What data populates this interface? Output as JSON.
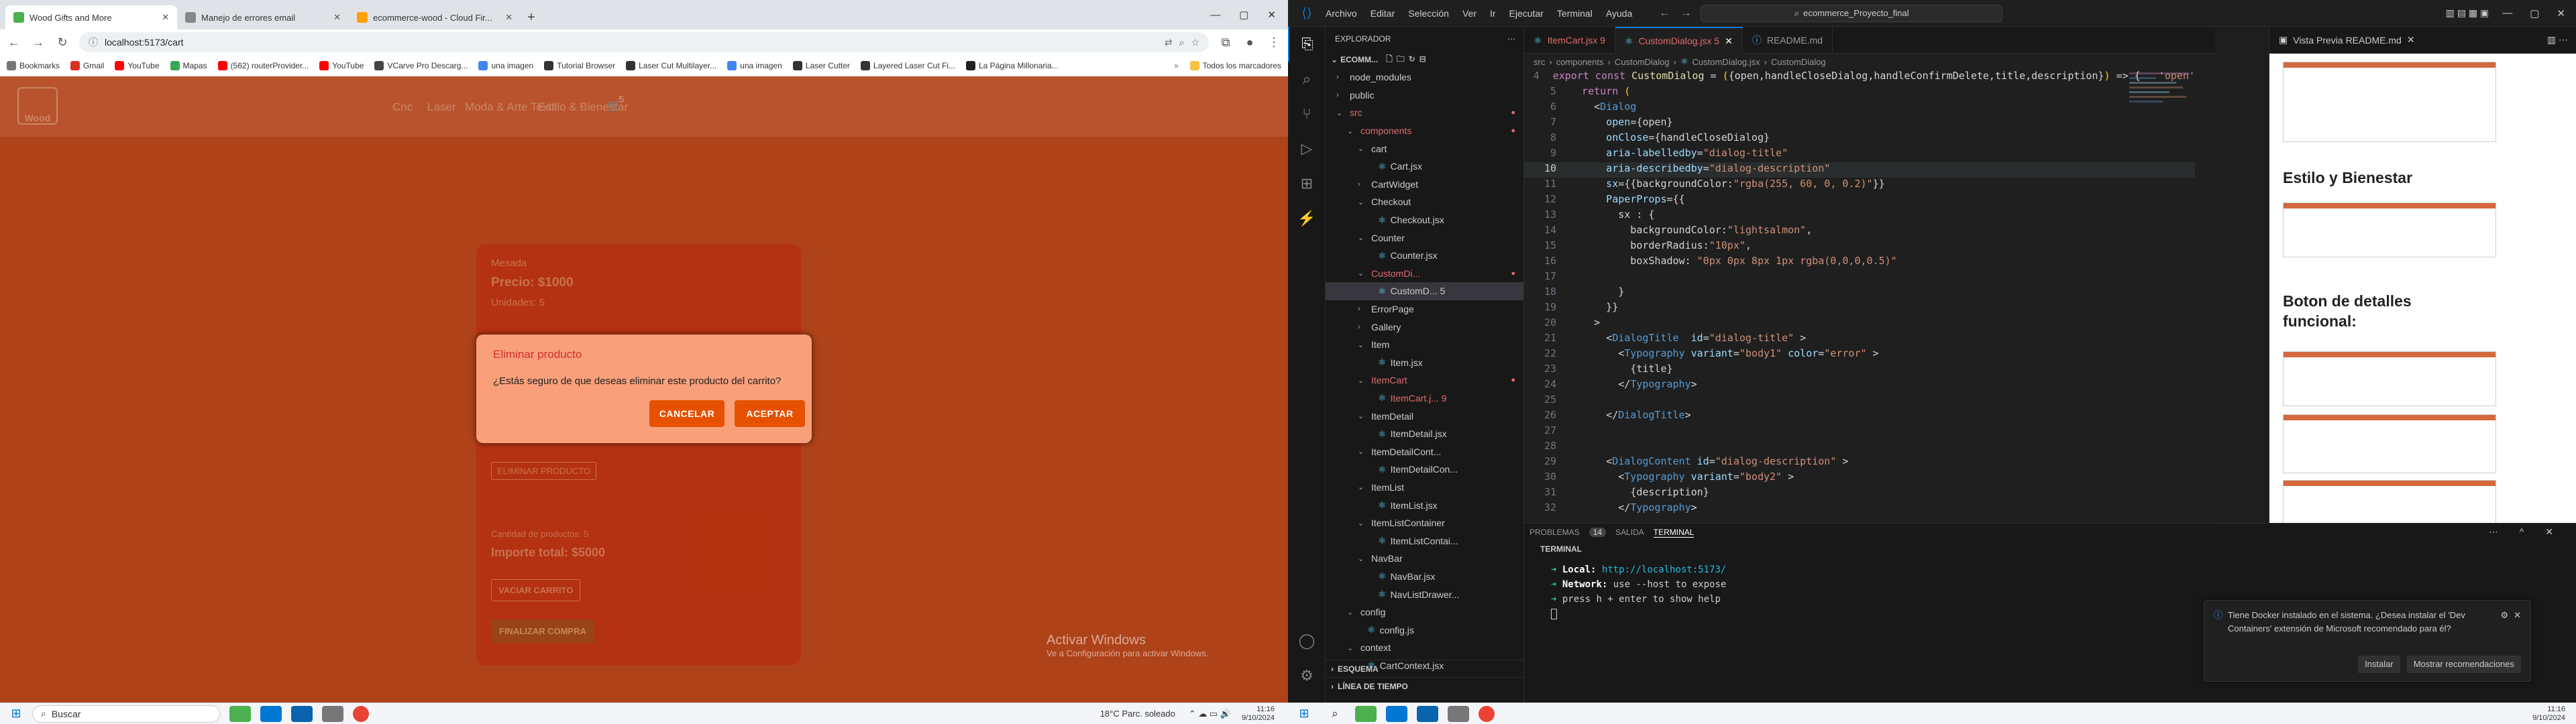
{
  "browser": {
    "tabs": [
      {
        "title": "Wood Gifts and More",
        "active": true,
        "favicon_color": "#4caf50"
      },
      {
        "title": "Manejo de errores email",
        "active": false,
        "favicon_color": "#888"
      },
      {
        "title": "ecommerce-wood - Cloud Fir...",
        "active": false,
        "favicon_color": "#ffa000"
      }
    ],
    "url": "localhost:5173/cart",
    "bookmarks": [
      "Bookmarks",
      "Gmail",
      "YouTube",
      "Mapas",
      "(562) routerProvider...",
      "YouTube",
      "VCarve Pro Descarg...",
      "una imagen",
      "Tutorial Browser",
      "Laser Cut Multilayer...",
      "una imagen",
      "Laser Cutter",
      "Layered Laser Cut Fi...",
      "La Página Millonaria..."
    ],
    "bookmarks_all": "Todos los marcadores"
  },
  "site": {
    "logo": "Wood",
    "nav": [
      "Cnc",
      "Laser",
      "Moda & Arte Textil",
      "Estilo & Bienestar"
    ],
    "cart_count": "5",
    "cart": {
      "item_name": "Mesada",
      "price": "Precio: $1000",
      "units": "Unidades: 5",
      "eliminar": "ELIMINAR PRODUCTO",
      "total_products": "Cantidad de productos: 5",
      "total": "Importe total: $5000",
      "clear": "VACIAR CARRITO",
      "checkout": "FINALIZAR COMPRA"
    },
    "watermark_title": "Activar Windows",
    "watermark_sub": "Ve a Configuración para activar Windows."
  },
  "dialog": {
    "title": "Eliminar producto",
    "description": "¿Estás seguro de que deseas eliminar este producto del carrito?",
    "cancel": "CANCELAR",
    "accept": "ACEPTAR"
  },
  "taskbar_left": {
    "search": "Buscar",
    "weather": "18°C  Parc. soleado",
    "time": "11:16",
    "date": "9/10/2024"
  },
  "vscode": {
    "menus": [
      "Archivo",
      "Editar",
      "Selección",
      "Ver",
      "Ir",
      "Ejecutar",
      "Terminal",
      "Ayuda"
    ],
    "search": "ecommerce_Proyecto_final",
    "explorer_title": "EXPLORADOR",
    "root": "ECOMM...",
    "tree": [
      {
        "name": "node_modules",
        "indent": 1,
        "folder": true,
        "open": false
      },
      {
        "name": "public",
        "indent": 1,
        "folder": true,
        "open": false
      },
      {
        "name": "src",
        "indent": 1,
        "folder": true,
        "open": true,
        "err": true
      },
      {
        "name": "components",
        "indent": 2,
        "folder": true,
        "open": true,
        "err": true
      },
      {
        "name": "cart",
        "indent": 3,
        "folder": true,
        "open": true
      },
      {
        "name": "Cart.jsx",
        "indent": 4,
        "folder": false
      },
      {
        "name": "CartWidget",
        "indent": 3,
        "folder": true,
        "open": false
      },
      {
        "name": "Checkout",
        "indent": 3,
        "folder": true,
        "open": true
      },
      {
        "name": "Checkout.jsx",
        "indent": 4,
        "folder": false
      },
      {
        "name": "Counter",
        "indent": 3,
        "folder": true,
        "open": true
      },
      {
        "name": "Counter.jsx",
        "indent": 4,
        "folder": false
      },
      {
        "name": "CustomDi...",
        "indent": 3,
        "folder": true,
        "open": true,
        "err": true
      },
      {
        "name": "CustomD... 5",
        "indent": 4,
        "folder": false,
        "selected": true
      },
      {
        "name": "ErrorPage",
        "indent": 3,
        "folder": true,
        "open": false
      },
      {
        "name": "Gallery",
        "indent": 3,
        "folder": true,
        "open": false
      },
      {
        "name": "Item",
        "indent": 3,
        "folder": true,
        "open": true
      },
      {
        "name": "Item.jsx",
        "indent": 4,
        "folder": false
      },
      {
        "name": "ItemCart",
        "indent": 3,
        "folder": true,
        "open": true,
        "err": true
      },
      {
        "name": "ItemCart.j... 9",
        "indent": 4,
        "folder": false,
        "err": true
      },
      {
        "name": "ItemDetail",
        "indent": 3,
        "folder": true,
        "open": true
      },
      {
        "name": "ItemDetail.jsx",
        "indent": 4,
        "folder": false
      },
      {
        "name": "ItemDetailCont...",
        "indent": 3,
        "folder": true,
        "open": true
      },
      {
        "name": "ItemDetailCon...",
        "indent": 4,
        "folder": false
      },
      {
        "name": "ItemList",
        "indent": 3,
        "folder": true,
        "open": true
      },
      {
        "name": "ItemList.jsx",
        "indent": 4,
        "folder": false
      },
      {
        "name": "ItemListContainer",
        "indent": 3,
        "folder": true,
        "open": true
      },
      {
        "name": "ItemListContai...",
        "indent": 4,
        "folder": false
      },
      {
        "name": "NavBar",
        "indent": 3,
        "folder": true,
        "open": true
      },
      {
        "name": "NavBar.jsx",
        "indent": 4,
        "folder": false
      },
      {
        "name": "NavListDrawer...",
        "indent": 4,
        "folder": false
      },
      {
        "name": "config",
        "indent": 2,
        "folder": true,
        "open": true
      },
      {
        "name": "config.js",
        "indent": 3,
        "folder": false
      },
      {
        "name": "context",
        "indent": 2,
        "folder": true,
        "open": true
      },
      {
        "name": "CartContext.jsx",
        "indent": 3,
        "folder": false
      }
    ],
    "outline": "ESQUEMA",
    "timeline": "LÍNEA DE TIEMPO",
    "editor_tabs": [
      {
        "label": "ItemCart.jsx 9",
        "active": false
      },
      {
        "label": "CustomDialog.jsx 5",
        "active": true
      },
      {
        "label": "README.md",
        "active": false
      }
    ],
    "breadcrumb": [
      "src",
      "components",
      "CustomDialog",
      "CustomDialog.jsx",
      "CustomDialog"
    ],
    "preview_tab": "Vista Previa README.md",
    "preview_headings": [
      "Estilo y Bienestar",
      "Boton de detalles funcional:"
    ],
    "panel_tabs": [
      "PROBLEMAS",
      "14",
      "SALIDA",
      "TERMINAL"
    ],
    "terminal_title": "TERMINAL",
    "terminal_lines": [
      {
        "arrow": "➜",
        "key": "Local:",
        "val": "http://localhost:5173/"
      },
      {
        "arrow": "➜",
        "key": "Network:",
        "val": "use --host to expose"
      },
      {
        "arrow": "➜",
        "key": "",
        "val": "press h + enter to show help"
      }
    ],
    "notification": "Tiene Docker instalado en el sistema. ¿Desea instalar el 'Dev Containers' extensión de Microsoft recomendado para él?",
    "notif_install": "Instalar",
    "notif_more": "Mostrar recomendaciones"
  },
  "taskbar_right": {
    "time": "11:16",
    "date": "9/10/2024"
  }
}
